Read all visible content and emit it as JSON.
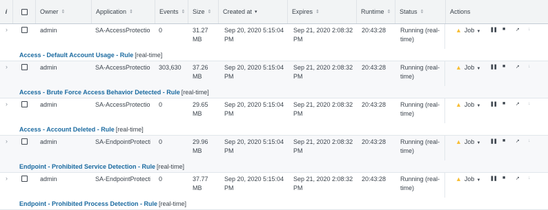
{
  "header": {
    "info": "i",
    "owner": "Owner",
    "application": "Application",
    "events": "Events",
    "size": "Size",
    "created_at": "Created at",
    "expires": "Expires",
    "runtime": "Runtime",
    "status": "Status",
    "actions": "Actions"
  },
  "icons": {
    "sort": "⇕",
    "sort_desc": "▾",
    "expander": "›",
    "warning": "▲",
    "dropdown": "▼",
    "pause": "❚❚",
    "stop": "■",
    "share": "↗",
    "download": "↓"
  },
  "colors": {
    "link": "#1a6aa0",
    "warning": "#f8be34",
    "shaded_row": "#f7f8fa"
  },
  "rows": [
    {
      "owner": "admin",
      "application": "SA-AccessProtection",
      "events": "0",
      "size_num": "31.27",
      "size_unit": "MB",
      "created_date": "Sep 20, 2020 5:15:04",
      "created_time": "PM",
      "expires_date": "Sep 21, 2020 2:08:32",
      "expires_time": "PM",
      "runtime": "20:43:28",
      "status_line1": "Running (real-",
      "status_line2": "time)",
      "job": "Job",
      "search_name": "Access - Default Account Usage - Rule",
      "search_suffix": "[real-time]"
    },
    {
      "owner": "admin",
      "application": "SA-AccessProtection",
      "events": "303,630",
      "size_num": "37.26",
      "size_unit": "MB",
      "created_date": "Sep 20, 2020 5:15:04",
      "created_time": "PM",
      "expires_date": "Sep 21, 2020 2:08:32",
      "expires_time": "PM",
      "runtime": "20:43:28",
      "status_line1": "Running (real-",
      "status_line2": "time)",
      "job": "Job",
      "search_name": "Access - Brute Force Access Behavior Detected - Rule",
      "search_suffix": "[real-time]"
    },
    {
      "owner": "admin",
      "application": "SA-AccessProtection",
      "events": "0",
      "size_num": "29.65",
      "size_unit": "MB",
      "created_date": "Sep 20, 2020 5:15:04",
      "created_time": "PM",
      "expires_date": "Sep 21, 2020 2:08:32",
      "expires_time": "PM",
      "runtime": "20:43:28",
      "status_line1": "Running (real-",
      "status_line2": "time)",
      "job": "Job",
      "search_name": "Access - Account Deleted - Rule",
      "search_suffix": "[real-time]"
    },
    {
      "owner": "admin",
      "application": "SA-EndpointProtection",
      "events": "0",
      "size_num": "29.96",
      "size_unit": "MB",
      "created_date": "Sep 20, 2020 5:15:04",
      "created_time": "PM",
      "expires_date": "Sep 21, 2020 2:08:32",
      "expires_time": "PM",
      "runtime": "20:43:28",
      "status_line1": "Running (real-",
      "status_line2": "time)",
      "job": "Job",
      "search_name": "Endpoint - Prohibited Service Detection - Rule",
      "search_suffix": "[real-time]"
    },
    {
      "owner": "admin",
      "application": "SA-EndpointProtection",
      "events": "0",
      "size_num": "37.77",
      "size_unit": "MB",
      "created_date": "Sep 20, 2020 5:15:04",
      "created_time": "PM",
      "expires_date": "Sep 21, 2020 2:08:32",
      "expires_time": "PM",
      "runtime": "20:43:28",
      "status_line1": "Running (real-",
      "status_line2": "time)",
      "job": "Job",
      "search_name": "Endpoint - Prohibited Process Detection - Rule",
      "search_suffix": "[real-time]"
    }
  ]
}
